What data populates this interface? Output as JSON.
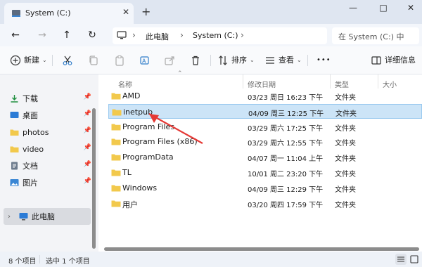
{
  "window": {
    "tab_title": "System (C:)",
    "tab_close": "✕",
    "new_tab": "+",
    "minimize": "—",
    "maximize": "□",
    "close": "✕"
  },
  "nav": {
    "back": "←",
    "forward": "→",
    "up": "↑",
    "refresh": "↻",
    "more": "›",
    "address": [
      "此电脑",
      "System (C:)"
    ],
    "search_placeholder": "在 System (C:) 中"
  },
  "toolbar": {
    "new_label": "新建",
    "sort_label": "排序",
    "view_label": "查看",
    "more_label": "•••",
    "details_label": "详细信息"
  },
  "sidebar": {
    "items": [
      {
        "label": "下载",
        "icon": "download-icon",
        "pinned": true
      },
      {
        "label": "桌面",
        "icon": "desktop-icon",
        "pinned": true
      },
      {
        "label": "photos",
        "icon": "folder-icon",
        "pinned": true
      },
      {
        "label": "video",
        "icon": "folder-icon",
        "pinned": true
      },
      {
        "label": "文档",
        "icon": "document-icon",
        "pinned": true
      },
      {
        "label": "图片",
        "icon": "picture-icon",
        "pinned": true
      }
    ],
    "this_pc": "此电脑"
  },
  "columns": {
    "name": "名称",
    "date": "修改日期",
    "type": "类型",
    "size": "大小"
  },
  "files": [
    {
      "name": "AMD",
      "date": "03/23 周日 16:23 下午",
      "type": "文件夹",
      "selected": false
    },
    {
      "name": "inetpub",
      "date": "04/09 周三 12:25 下午",
      "type": "文件夹",
      "selected": true
    },
    {
      "name": "Program Files",
      "date": "03/29 周六 17:25 下午",
      "type": "文件夹",
      "selected": false
    },
    {
      "name": "Program Files (x86)",
      "date": "03/29 周六 12:55 下午",
      "type": "文件夹",
      "selected": false
    },
    {
      "name": "ProgramData",
      "date": "04/07 周一 11:04 上午",
      "type": "文件夹",
      "selected": false
    },
    {
      "name": "TL",
      "date": "10/01 周二 23:20 下午",
      "type": "文件夹",
      "selected": false
    },
    {
      "name": "Windows",
      "date": "04/09 周三 12:29 下午",
      "type": "文件夹",
      "selected": false
    },
    {
      "name": "用户",
      "date": "03/20 周四 17:59 下午",
      "type": "文件夹",
      "selected": false
    }
  ],
  "status": {
    "item_count": "8 个项目",
    "selected_count": "选中 1 个项目"
  },
  "colors": {
    "selection_bg": "#cce4f7",
    "selection_border": "#99c9ef",
    "folder": "#f2c94c",
    "annotation_arrow": "#e53935"
  }
}
